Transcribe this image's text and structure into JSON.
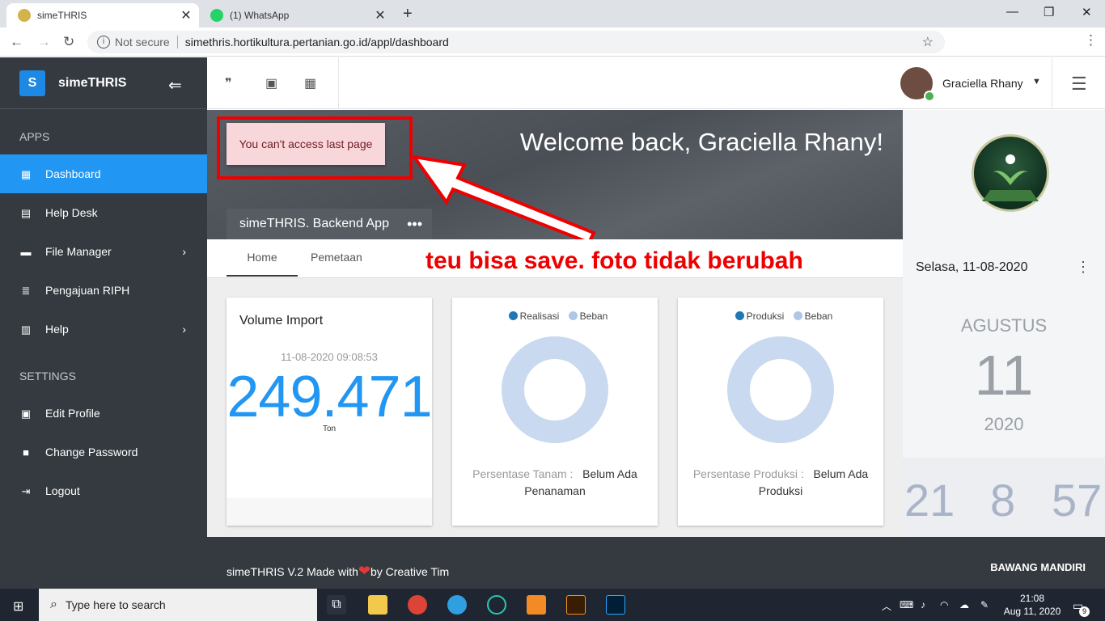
{
  "browser": {
    "tabs": [
      {
        "title": "simeTHRIS",
        "close": "✕"
      },
      {
        "title": "(1) WhatsApp",
        "close": "✕"
      }
    ],
    "new_tab": "+",
    "security": "Not secure",
    "url": "simethris.hortikultura.pertanian.go.id/appl/dashboard",
    "window_controls": [
      "—",
      "❐",
      "✕"
    ]
  },
  "sidebar": {
    "logo_letter": "S",
    "brand": "simeTHRIS",
    "section_apps": "APPS",
    "apps": [
      {
        "label": "Dashboard",
        "icon": "dashboard-icon",
        "active": true
      },
      {
        "label": "Help Desk",
        "icon": "forum-icon"
      },
      {
        "label": "File Manager",
        "icon": "folder-icon",
        "arrow": "›"
      },
      {
        "label": "Pengajuan RIPH",
        "icon": "stack-icon"
      },
      {
        "label": "Help",
        "icon": "book-icon",
        "arrow": "›"
      }
    ],
    "section_settings": "SETTINGS",
    "settings": [
      {
        "label": "Edit Profile",
        "icon": "profile-icon"
      },
      {
        "label": "Change Password",
        "icon": "lock-icon"
      },
      {
        "label": "Logout",
        "icon": "logout-icon"
      }
    ]
  },
  "header": {
    "user_name": "Graciella Rhany",
    "caret": "▼"
  },
  "hero": {
    "welcome": "Welcome back, Graciella Rhany!",
    "alert": "You can't access last page",
    "app_tab": "simeTHRIS. Backend App",
    "dots": "•••"
  },
  "tabs": {
    "home": "Home",
    "pemetaan": "Pemetaan"
  },
  "annotation": "teu bisa save. foto tidak berubah",
  "cards": {
    "volume": {
      "title": "Volume Import",
      "date": "11-08-2020 09:08:53",
      "value": "249.471",
      "unit": "Ton"
    },
    "tanam": {
      "legend": [
        "Realisasi",
        "Beban"
      ],
      "label": "Persentase Tanam :",
      "status": "Belum Ada",
      "status2": "Penanaman"
    },
    "produksi": {
      "legend": [
        "Produksi",
        "Beban"
      ],
      "label": "Persentase Produksi :",
      "status": "Belum Ada",
      "status2": "Produksi"
    }
  },
  "colors": {
    "realisasi": "#1f77b4",
    "beban": "#aec7e8",
    "donut": "#c9d9ef",
    "accent": "#2196f3"
  },
  "right_panel": {
    "date": "Selasa, 11-08-2020",
    "month": "AGUSTUS",
    "day": "11",
    "year": "2020",
    "clock": [
      "21",
      "8",
      "57"
    ]
  },
  "footer": {
    "left_a": "simeTHRIS V.2 Made with",
    "left_b": "by Creative Tim",
    "right": "BAWANG MANDIRI"
  },
  "taskbar": {
    "search_placeholder": "Type here to search",
    "time": "21:08",
    "date": "Aug 11, 2020",
    "notifications": "9"
  }
}
